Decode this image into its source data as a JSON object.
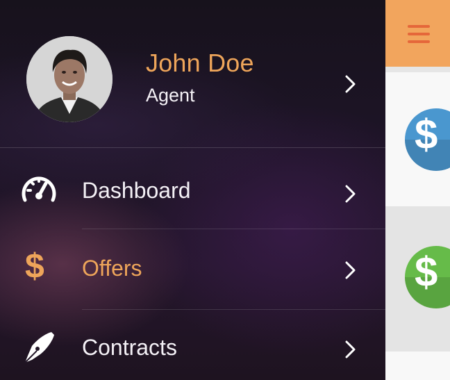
{
  "profile": {
    "name": "John Doe",
    "role": "Agent",
    "avatar_icon": "user-photo",
    "chevron_icon": "chevron-right-icon"
  },
  "menu": {
    "items": [
      {
        "label": "Dashboard",
        "icon": "speedometer-icon",
        "active": false
      },
      {
        "label": "Offers",
        "icon": "dollar-icon",
        "active": true,
        "glyph": "$"
      },
      {
        "label": "Contracts",
        "icon": "fountain-pen-icon",
        "active": false
      }
    ]
  },
  "main": {
    "menu_icon": "hamburger-icon",
    "cards": [
      {
        "icon": "dollar-coin-icon",
        "glyph": "$",
        "color": "#4a97cf"
      },
      {
        "icon": "dollar-coin-icon",
        "glyph": "$",
        "color": "#66bb49"
      }
    ]
  },
  "colors": {
    "accent": "#eea55a",
    "topbar": "#f2a55d",
    "hamburger": "#e5673a",
    "text_light": "#f4f1f6"
  }
}
